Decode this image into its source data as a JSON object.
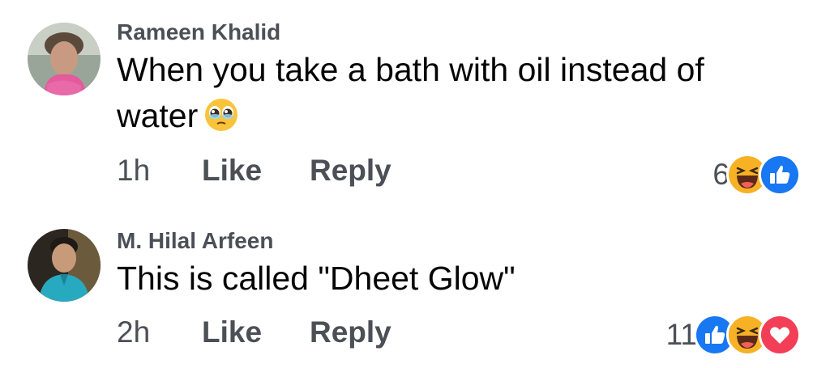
{
  "comments": [
    {
      "author": "Rameen Khalid",
      "text": "When you take a bath with oil instead of water",
      "text_line1": "When you take a bath with oil instead of",
      "text_line2": "water",
      "inline_emoji": "pleading-face-icon",
      "time": "1h",
      "like_label": "Like",
      "reply_label": "Reply",
      "reaction_count": "6",
      "reactions": [
        "haha-icon",
        "like-icon"
      ]
    },
    {
      "author": "M. Hilal Arfeen",
      "text": "This is called \"Dheet Glow\"",
      "time": "2h",
      "like_label": "Like",
      "reply_label": "Reply",
      "reaction_count": "11",
      "reactions": [
        "like-icon",
        "haha-icon",
        "love-icon"
      ]
    }
  ],
  "colors": {
    "like_blue": "#1877f2",
    "love_red": "#f33e58",
    "haha_yellow": "#f7b125",
    "meta_gray": "#4b4f56"
  }
}
